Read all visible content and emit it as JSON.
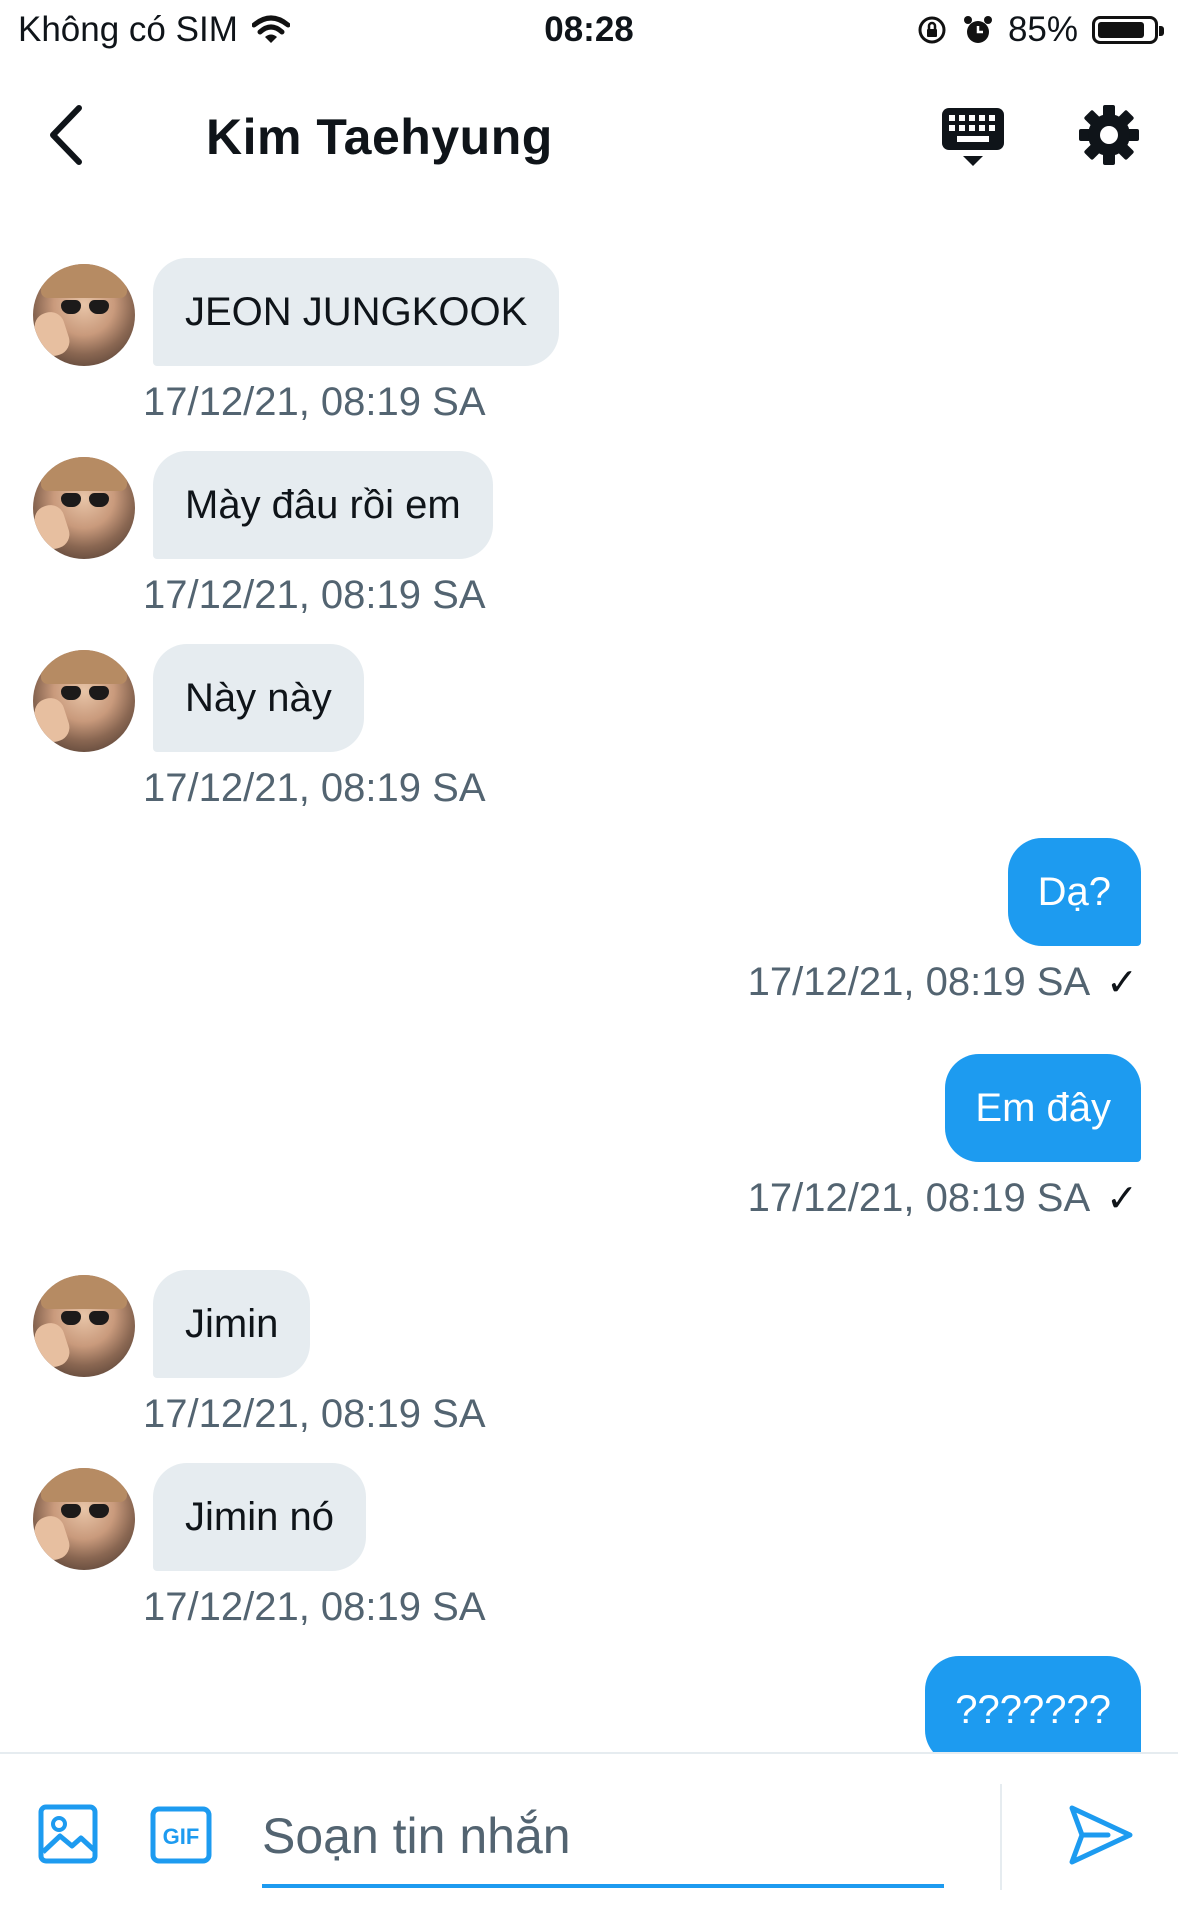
{
  "status_bar": {
    "carrier": "Không có SIM",
    "time": "08:28",
    "battery": "85%",
    "battery_level": 0.85
  },
  "header": {
    "title": "Kim Taehyung",
    "icons": {
      "back": "chevron-left-icon",
      "keyboard": "keyboard-icon",
      "settings": "gear-icon"
    }
  },
  "messages": [
    {
      "direction": "in",
      "text": "JEON JUNGKOOK",
      "time": "17/12/21, 08:19 SA"
    },
    {
      "direction": "in",
      "text": "Mày đâu rồi em",
      "time": "17/12/21, 08:19 SA"
    },
    {
      "direction": "in",
      "text": "Này này",
      "time": "17/12/21, 08:19 SA"
    },
    {
      "direction": "out",
      "text": "Dạ?",
      "time": "17/12/21, 08:19 SA",
      "status": "✓"
    },
    {
      "direction": "out",
      "text": "Em đây",
      "time": "17/12/21, 08:19 SA",
      "status": "✓"
    },
    {
      "direction": "in",
      "text": "Jimin",
      "time": "17/12/21, 08:19 SA"
    },
    {
      "direction": "in",
      "text": "Jimin nó",
      "time": "17/12/21, 08:19 SA"
    },
    {
      "direction": "out",
      "text": "???????",
      "time": "",
      "status": ""
    }
  ],
  "composer": {
    "placeholder": "Soạn tin nhắn",
    "value": "",
    "gif_label": "GIF",
    "icons": {
      "image": "image-icon",
      "gif": "gif-icon",
      "send": "send-icon"
    }
  },
  "colors": {
    "accent": "#1d9bf0",
    "incoming_bubble": "#e6ecf0",
    "secondary_text": "#536471",
    "primary_text": "#0f1419"
  }
}
